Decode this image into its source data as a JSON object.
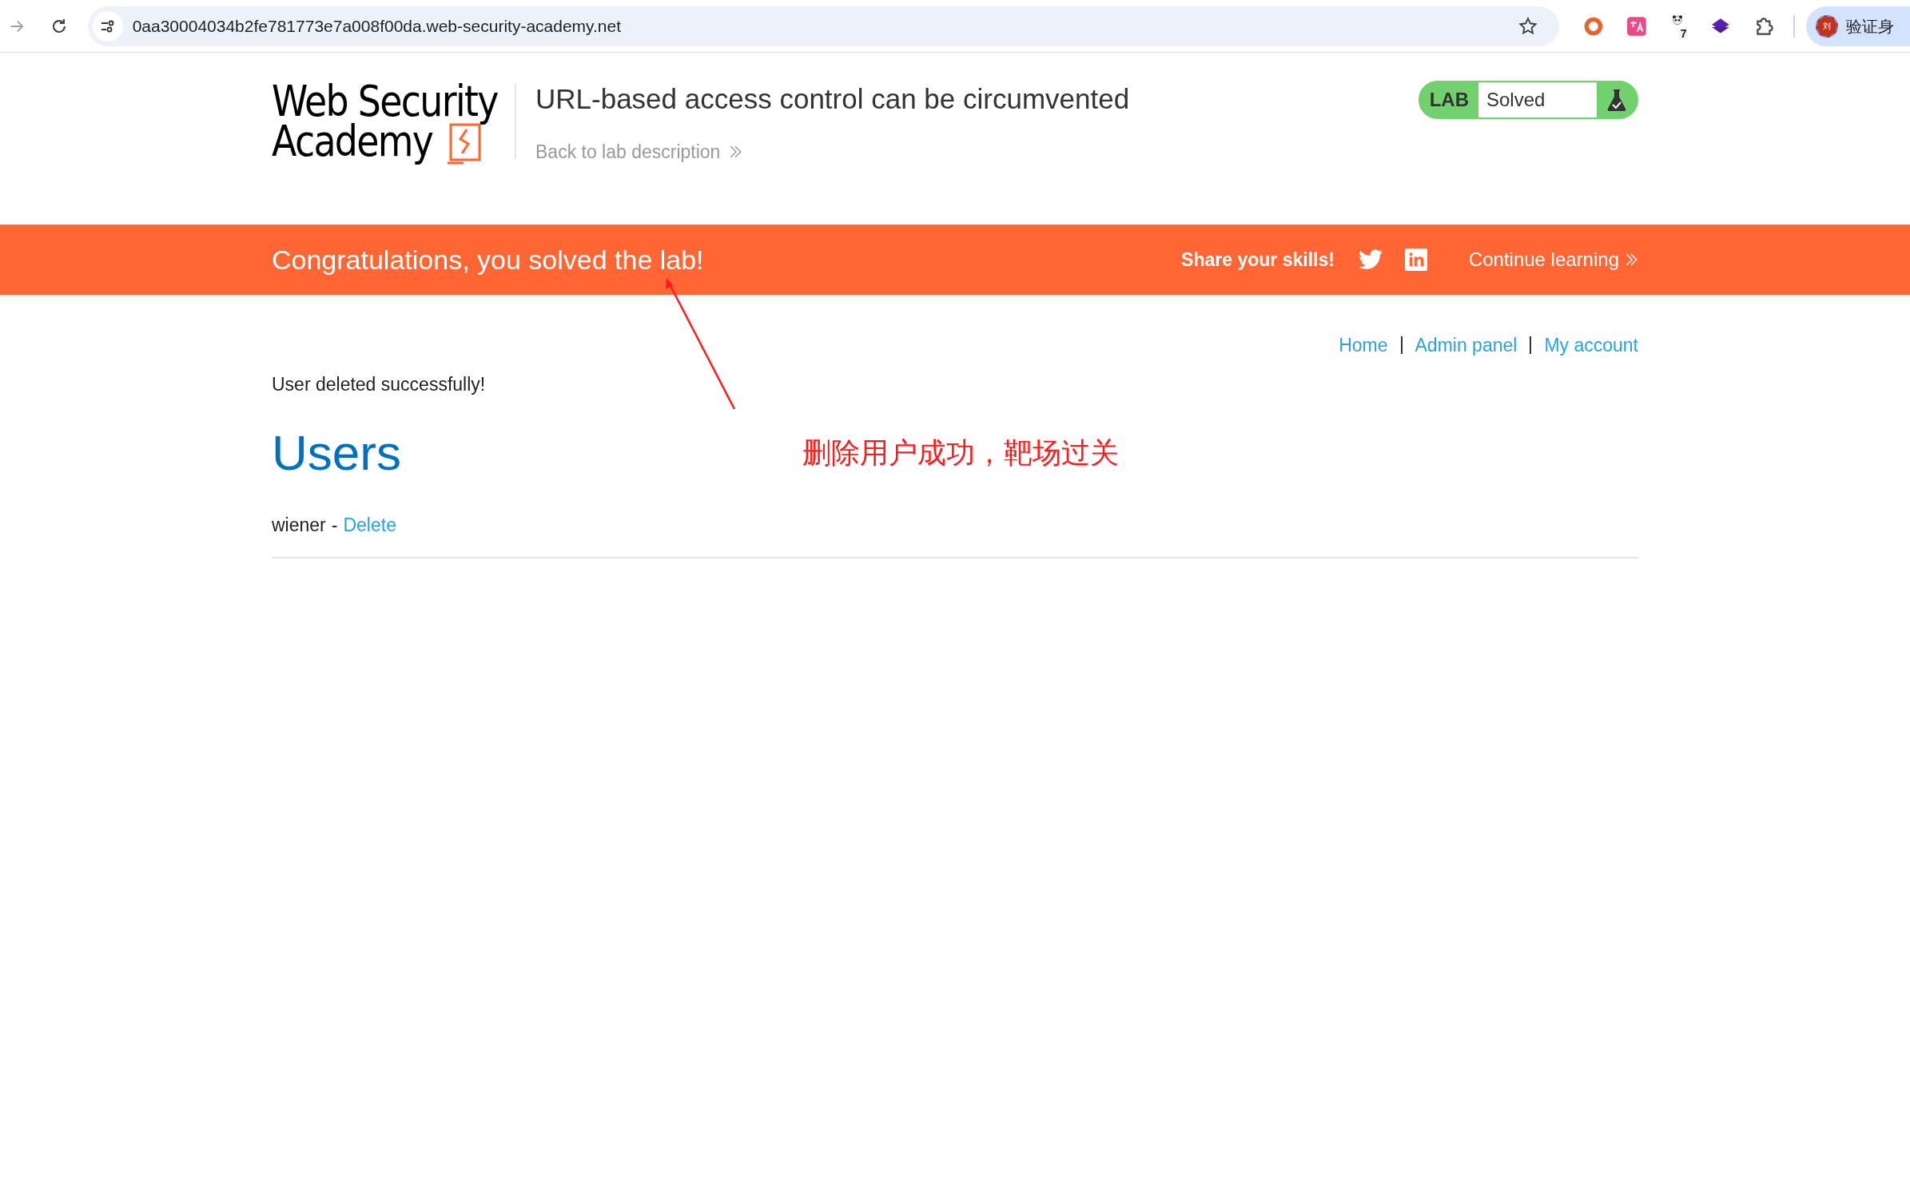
{
  "browser": {
    "url": "0aa30004034b2fe781773e7a008f00da.web-security-academy.net",
    "extension_badge": "7",
    "profile": {
      "avatar": "刘",
      "label": "验证身"
    }
  },
  "header": {
    "logo": [
      "Web Security",
      "Academy"
    ],
    "title": "URL-based access control can be circumvented",
    "back_link": "Back to lab description",
    "status": {
      "label": "LAB",
      "value": "Solved",
      "solved": true
    }
  },
  "banner": {
    "message": "Congratulations, you solved the lab!",
    "share": "Share your skills!",
    "continue": "Continue learning"
  },
  "nav": [
    "Home",
    "Admin panel",
    "My account"
  ],
  "notice": "User deleted successfully!",
  "heading": "Users",
  "users": [
    {
      "name": "wiener",
      "separator": "-",
      "action": "Delete"
    }
  ],
  "annotation": "删除用户成功，靶场过关"
}
